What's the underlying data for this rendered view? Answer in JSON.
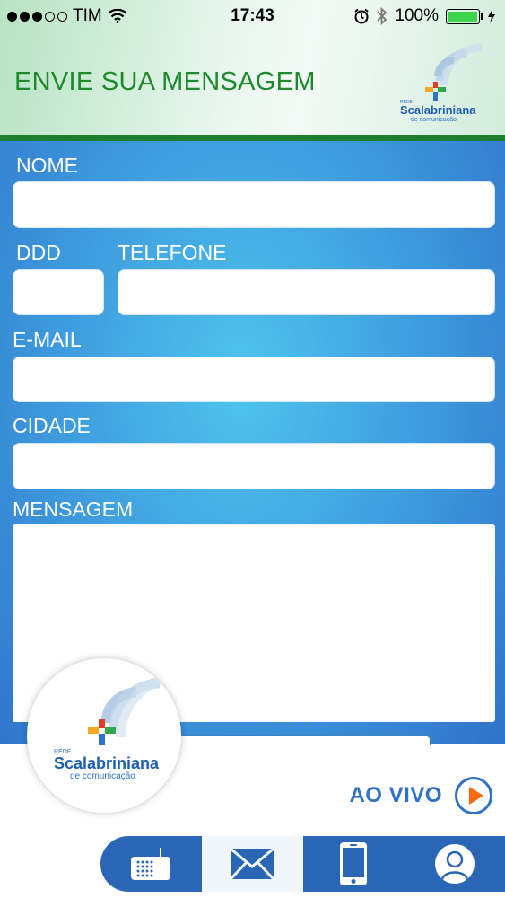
{
  "status_bar": {
    "carrier": "TIM",
    "time": "17:43",
    "battery": "100%"
  },
  "header": {
    "title": "ENVIE SUA MENSAGEM"
  },
  "brand": {
    "small": "REDE",
    "name": "Scalabriniana",
    "tagline": "de comunicação"
  },
  "form": {
    "nome_label": "NOME",
    "nome_value": "",
    "ddd_label": "DDD",
    "ddd_value": "",
    "telefone_label": "TELEFONE",
    "telefone_value": "",
    "email_label": "E-MAIL",
    "email_value": "",
    "cidade_label": "CIDADE",
    "cidade_value": "",
    "mensagem_label": "MENSAGEM",
    "mensagem_value": ""
  },
  "player": {
    "live_label": "AO VIVO"
  },
  "tabs": [
    {
      "icon": "radio-icon"
    },
    {
      "icon": "envelope-icon",
      "active": true
    },
    {
      "icon": "smartphone-icon"
    },
    {
      "icon": "user-profile-icon"
    }
  ],
  "colors": {
    "header_green": "#1e8a2c",
    "form_blue": "#3f9fdf",
    "tab_blue": "#2a66b6",
    "play_orange": "#ff6a10"
  }
}
